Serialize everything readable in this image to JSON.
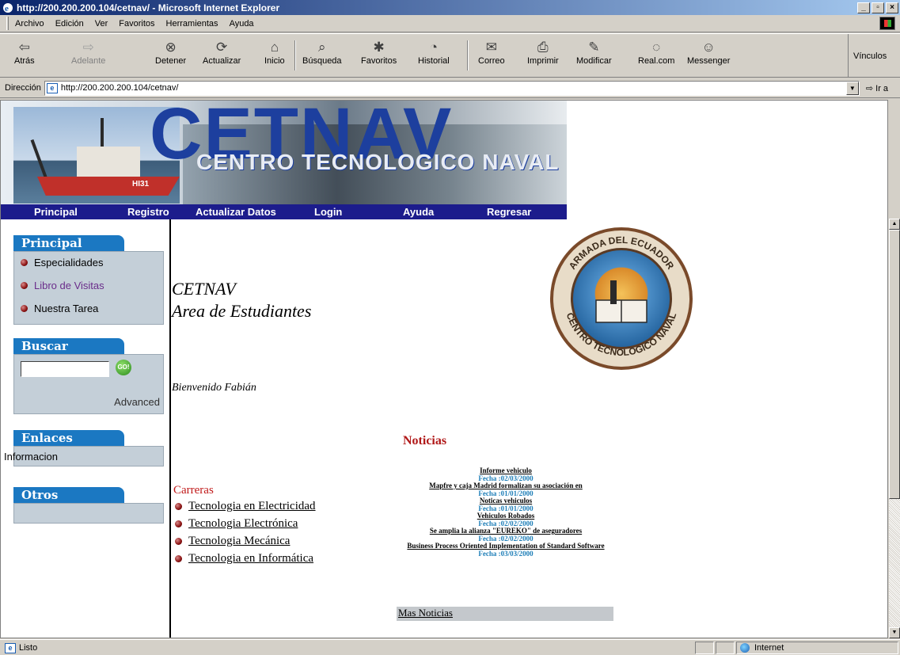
{
  "window": {
    "title": "http://200.200.200.104/cetnav/ - Microsoft Internet Explorer"
  },
  "menubar": {
    "items": [
      "Archivo",
      "Edición",
      "Ver",
      "Favoritos",
      "Herramientas",
      "Ayuda"
    ]
  },
  "toolbar": {
    "buttons": [
      {
        "label": "Atrás",
        "icon": "back-arrow-icon"
      },
      {
        "label": "Adelante",
        "icon": "forward-arrow-icon"
      },
      {
        "label": "Detener",
        "icon": "stop-icon"
      },
      {
        "label": "Actualizar",
        "icon": "refresh-icon"
      },
      {
        "label": "Inicio",
        "icon": "home-icon"
      },
      {
        "label": "Búsqueda",
        "icon": "search-icon"
      },
      {
        "label": "Favoritos",
        "icon": "favorites-icon"
      },
      {
        "label": "Historial",
        "icon": "history-icon"
      },
      {
        "label": "Correo",
        "icon": "mail-icon"
      },
      {
        "label": "Imprimir",
        "icon": "print-icon"
      },
      {
        "label": "Modificar",
        "icon": "edit-icon"
      },
      {
        "label": "Real.com",
        "icon": "realcom-icon"
      },
      {
        "label": "Messenger",
        "icon": "messenger-icon"
      }
    ],
    "links_label": "Vínculos"
  },
  "address": {
    "label": "Dirección",
    "url": "http://200.200.200.104/cetnav/",
    "go_label": "Ir a"
  },
  "banner": {
    "brand": "CETNAV",
    "subtitle": "CENTRO TECNOLOGICO NAVAL",
    "hull_number": "HI31"
  },
  "nav": {
    "items": [
      "Principal",
      "Registro",
      "Actualizar Datos",
      "Login",
      "Ayuda",
      "Regresar"
    ]
  },
  "sidebar": {
    "principal": {
      "title": "Principal",
      "items": [
        "Especialidades",
        "Libro de Visitas",
        "Nuestra Tarea"
      ]
    },
    "buscar": {
      "title": "Buscar",
      "go_label": "GO!",
      "advanced": "Advanced",
      "query": ""
    },
    "enlaces": {
      "title": "Enlaces",
      "items": [
        "Informacion"
      ]
    },
    "otros": {
      "title": "Otros"
    }
  },
  "main": {
    "title_line1": "CETNAV",
    "title_line2": "Area de Estudiantes",
    "welcome": "Bienvenido Fabián",
    "emblem": {
      "top_text": "ARMADA DEL ECUADOR",
      "bottom_text": "CENTRO TECNOLOGICO NAVAL"
    },
    "carreras": {
      "title": "Carreras",
      "items": [
        "Tecnologia en Electricidad",
        "Tecnologia Electrónica",
        "Tecnologia Mecánica",
        "Tecnologia en Informática"
      ]
    },
    "noticias": {
      "title": "Noticias",
      "items": [
        {
          "title": "Informe vehiculo",
          "date": "Fecha :02/03/2000"
        },
        {
          "title": "Mapfre y caja Madrid formalizan su asociación en",
          "date": "Fecha :01/01/2000"
        },
        {
          "title": "Noticas vehiculos",
          "date": "Fecha :01/01/2000"
        },
        {
          "title": "Vehiculos Robados",
          "date": "Fecha :02/02/2000"
        },
        {
          "title": "Se amplia la alianza \"EUREKO\" de aseguradores",
          "date": "Fecha :02/02/2000"
        },
        {
          "title": "Business Process Oriented Implementation of Standard Software",
          "date": "Fecha :03/03/2000"
        }
      ],
      "more": "Mas Noticias"
    }
  },
  "status": {
    "text": "Listo",
    "zone": "Internet"
  }
}
